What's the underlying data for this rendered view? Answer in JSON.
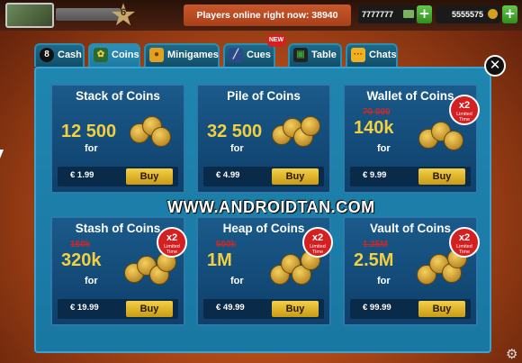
{
  "header": {
    "level": "6",
    "online_text": "Players online right now: 38940",
    "cash_amount": "7777777",
    "coins_amount": "5555575"
  },
  "tabs": [
    {
      "label": "Cash",
      "icon": "cash-8ball-icon"
    },
    {
      "label": "Coins",
      "icon": "coins-icon"
    },
    {
      "label": "Minigames",
      "icon": "minigames-icon"
    },
    {
      "label": "Cues",
      "icon": "cues-icon",
      "badge": "NEW"
    },
    {
      "label": "Table",
      "icon": "table-icon"
    },
    {
      "label": "Chats",
      "icon": "chats-icon"
    }
  ],
  "active_tab": "Coins",
  "offers": [
    {
      "title": "Stack of Coins",
      "old": "",
      "amount": "12 500",
      "for": "for",
      "price": "€ 1.99",
      "buy": "Buy",
      "badge": null
    },
    {
      "title": "Pile of Coins",
      "old": "",
      "amount": "32 500",
      "for": "for",
      "price": "€ 4.99",
      "buy": "Buy",
      "badge": null
    },
    {
      "title": "Wallet of Coins",
      "old": "70 000",
      "amount": "140k",
      "for": "for",
      "price": "€ 9.99",
      "buy": "Buy",
      "badge": {
        "mult": "x2",
        "text": "Limited Time"
      }
    },
    {
      "title": "Stash of Coins",
      "old": "160k",
      "amount": "320k",
      "for": "for",
      "price": "€ 19.99",
      "buy": "Buy",
      "badge": {
        "mult": "x2",
        "text": "Limited Time"
      }
    },
    {
      "title": "Heap of Coins",
      "old": "500k",
      "amount": "1M",
      "for": "for",
      "price": "€ 49.99",
      "buy": "Buy",
      "badge": {
        "mult": "x2",
        "text": "Limited Time"
      }
    },
    {
      "title": "Vault of Coins",
      "old": "1.25M",
      "amount": "2.5M",
      "for": "for",
      "price": "€ 99.99",
      "buy": "Buy",
      "badge": {
        "mult": "x2",
        "text": "Limited Time"
      }
    }
  ],
  "watermark": "WWW.ANDROIDTAN.COM",
  "colors": {
    "panel": "#1f86b0",
    "card": "#0f3f6a",
    "amount": "#f2d040",
    "buy": "#f4d048",
    "badge": "#d42020"
  }
}
